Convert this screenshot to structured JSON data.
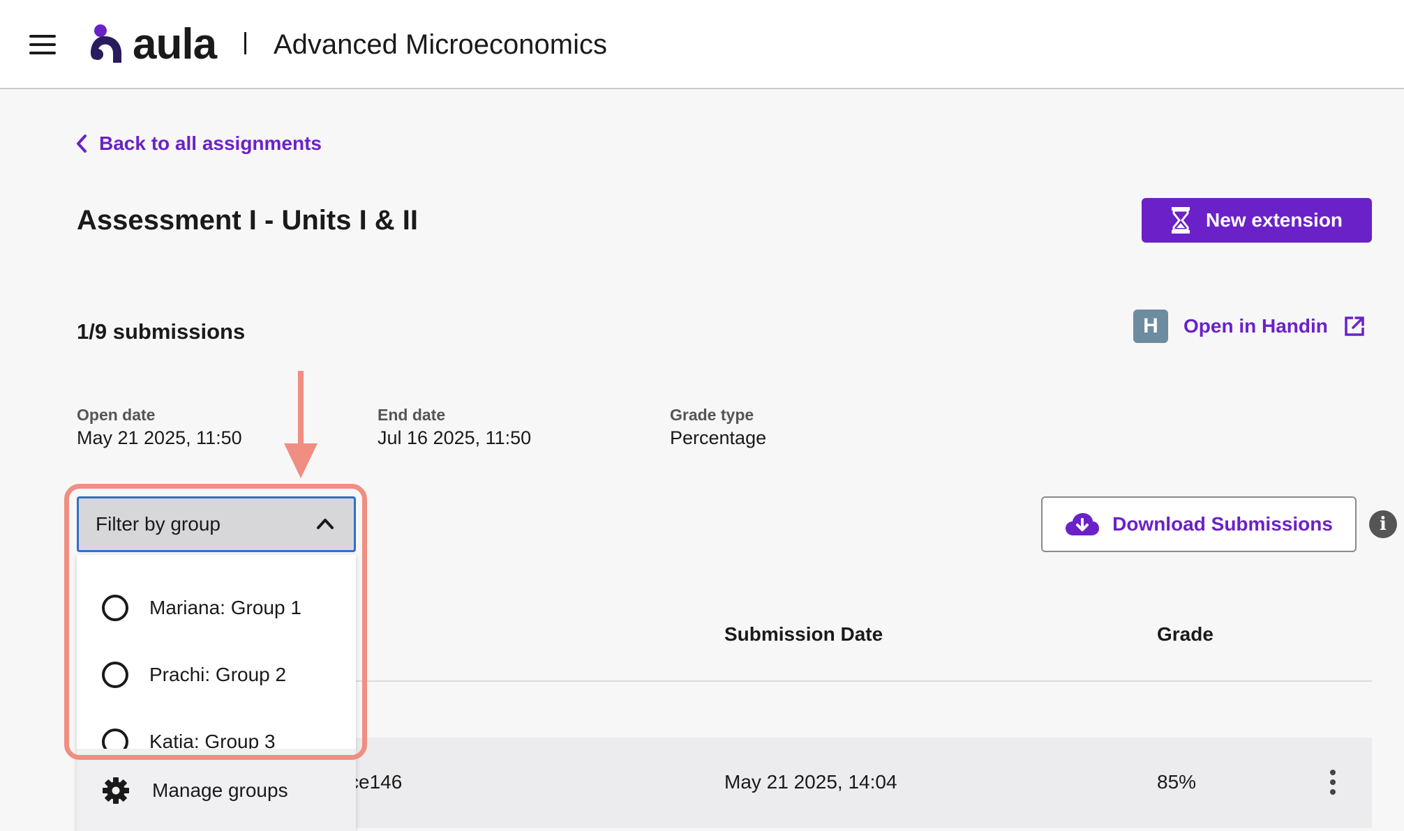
{
  "header": {
    "logo_text": "aula",
    "course_title": "Advanced Microeconomics"
  },
  "nav": {
    "back_label": "Back to all assignments"
  },
  "assignment": {
    "title": "Assessment I - Units I & II",
    "new_extension_label": "New extension",
    "submission_count": "1/9 submissions",
    "handin_badge": "H",
    "open_in_handin_label": "Open in Handin",
    "open_date_label": "Open date",
    "open_date_value": "May 21 2025, 11:50",
    "end_date_label": "End date",
    "end_date_value": "Jul 16 2025, 11:50",
    "grade_type_label": "Grade type",
    "grade_type_value": "Percentage"
  },
  "filter": {
    "label": "Filter by group",
    "options": [
      {
        "label": "Mariana: Group 1",
        "selected": false
      },
      {
        "label": "Prachi: Group 2",
        "selected": false
      },
      {
        "label": "Katia: Group 3",
        "selected": false
      }
    ],
    "manage_label": "Manage groups"
  },
  "actions": {
    "download_label": "Download Submissions",
    "info_glyph": "i"
  },
  "table": {
    "headers": [
      "Submission Date",
      "Grade"
    ],
    "rows": [
      {
        "student_partial": "ce146",
        "submission_date": "May 21 2025, 14:04",
        "grade": "85%"
      }
    ]
  },
  "colors": {
    "accent": "#6b21c8",
    "annotation": "#f08e82",
    "focus_border": "#2f6fc9",
    "handin_badge": "#6e8ca0"
  },
  "icons": [
    "hamburger-icon",
    "aula-logo-icon",
    "chevron-left-icon",
    "hourglass-icon",
    "external-link-icon",
    "chevron-up-icon",
    "radio-icon",
    "gear-icon",
    "cloud-download-icon",
    "info-icon",
    "kebab-icon",
    "annotation-arrow"
  ]
}
